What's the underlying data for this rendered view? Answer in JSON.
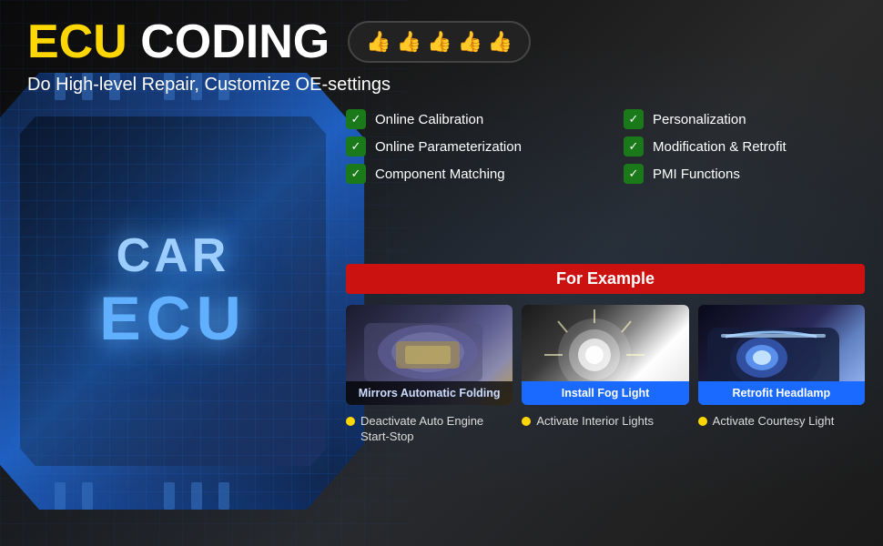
{
  "header": {
    "title_ecu": "ECU",
    "title_coding": "CODING",
    "subtitle": "Do High-level Repair, Customize OE-settings",
    "thumbs": [
      "👍",
      "👍",
      "👍",
      "👍",
      "👍"
    ]
  },
  "features": [
    {
      "id": "online-calibration",
      "label": "Online Calibration"
    },
    {
      "id": "personalization",
      "label": "Personalization"
    },
    {
      "id": "online-parameterization",
      "label": "Online Parameterization"
    },
    {
      "id": "modification-retrofit",
      "label": "Modification & Retrofit"
    },
    {
      "id": "component-matching",
      "label": "Component Matching"
    },
    {
      "id": "pmi-functions",
      "label": "PMI Functions"
    }
  ],
  "for_example": {
    "header": "For Example",
    "examples": [
      {
        "id": "mirrors-folding",
        "label": "Mirrors Automatic Folding",
        "type": "dark"
      },
      {
        "id": "install-fog",
        "label": "Install Fog Light",
        "type": "blue"
      },
      {
        "id": "retrofit-headlamp",
        "label": "Retrofit Headlamp",
        "type": "blue"
      }
    ],
    "extra_items": [
      {
        "id": "deactivate-engine",
        "label": "Deactivate Auto Engine Start-Stop"
      },
      {
        "id": "activate-interior",
        "label": "Activate Interior Lights"
      },
      {
        "id": "activate-courtesy",
        "label": "Activate Courtesy Light"
      }
    ]
  },
  "ecu_chip": {
    "car_label": "CAR",
    "ecu_label": "ECU"
  }
}
